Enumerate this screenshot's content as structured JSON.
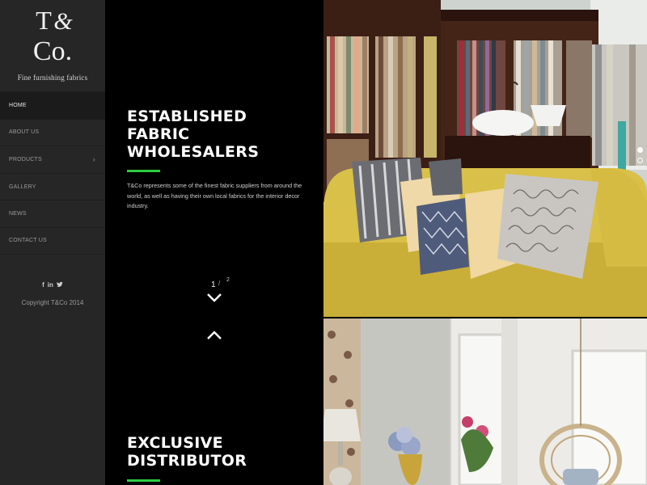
{
  "brand": {
    "logo_text": "T&Co.",
    "tagline": "Fine furnishing fabrics"
  },
  "nav": {
    "items": [
      {
        "label": "HOME",
        "active": true,
        "has_submenu": false
      },
      {
        "label": "ABOUT US",
        "active": false,
        "has_submenu": false
      },
      {
        "label": "PRODUCTS",
        "active": false,
        "has_submenu": true
      },
      {
        "label": "GALLERY",
        "active": false,
        "has_submenu": false
      },
      {
        "label": "NEWS",
        "active": false,
        "has_submenu": false
      },
      {
        "label": "CONTACT US",
        "active": false,
        "has_submenu": false
      }
    ],
    "submenu_icon": "chevron-right-icon"
  },
  "social": {
    "facebook": "f",
    "linkedin": "in",
    "twitter": "❧"
  },
  "footer": {
    "copyright": "Copyright T&Co 2014"
  },
  "sections": [
    {
      "heading_lines": [
        "ESTABLISHED",
        "FABRIC",
        "WHOLESALERS"
      ],
      "description": "T&Co represents some of the finest fabric suppliers from around the world, as well as having their own local fabrics for the interior decor industry."
    },
    {
      "heading_lines": [
        "EXCLUSIVE",
        "DISTRIBUTOR"
      ]
    }
  ],
  "pager": {
    "current": "1",
    "separator": "/",
    "total": "2"
  },
  "colors": {
    "accent": "#2ecc40",
    "sidebar_bg": "#262626",
    "panel_bg": "#000000"
  },
  "slider": {
    "active_dot": 1,
    "dot_count": 2
  }
}
